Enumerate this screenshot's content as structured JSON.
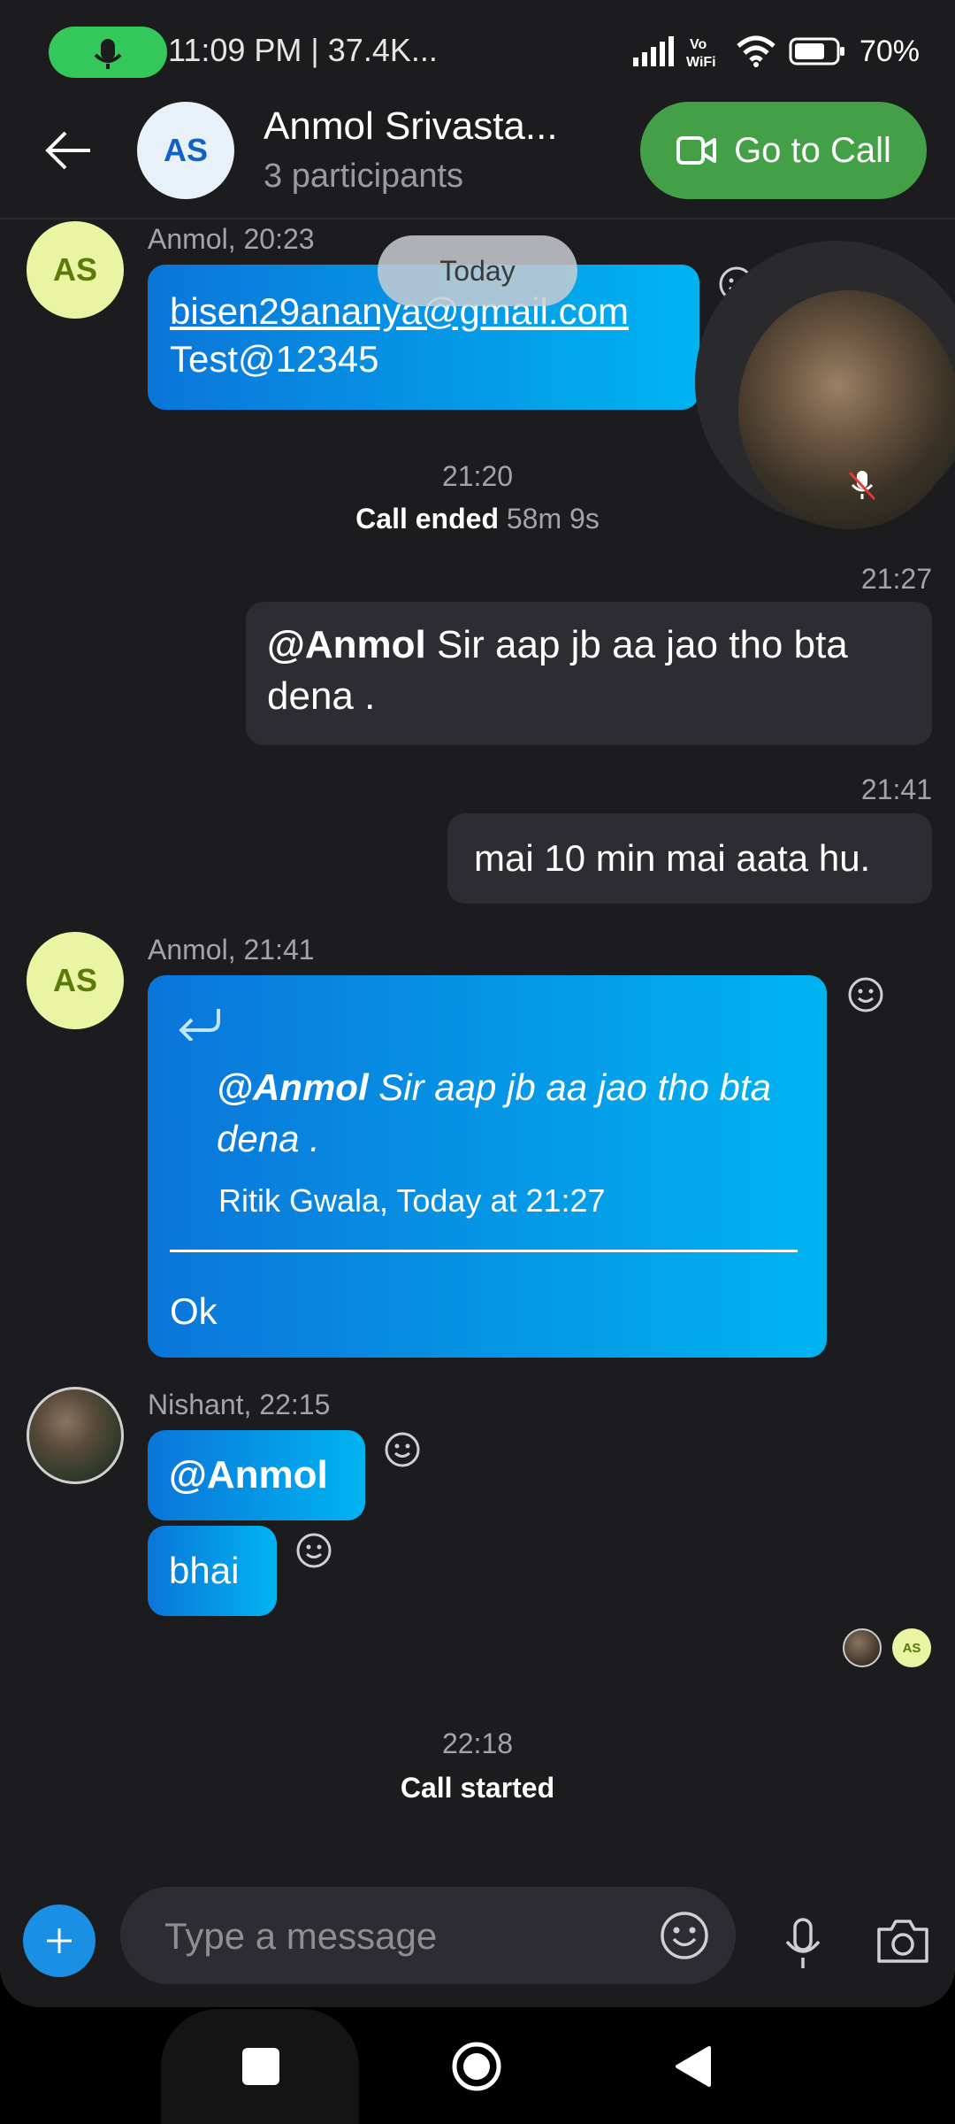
{
  "status_bar": {
    "time_data": "11:09 PM | 37.4K...",
    "battery": "70%"
  },
  "header": {
    "avatar_initials": "AS",
    "name": "Anmol Srivasta...",
    "participants": "3 participants",
    "call_button": "Go to Call"
  },
  "today_label": "Today",
  "messages": {
    "m1": {
      "author": "Anmol, 20:23",
      "avatar": "AS",
      "email": "bisen29ananya@gmail.com",
      "text": "Test@12345"
    },
    "call_ended": {
      "time": "21:20",
      "label": "Call ended",
      "duration": "58m 9s"
    },
    "m2": {
      "time": "21:27",
      "mention": "@Anmol",
      "text": " Sir aap jb aa jao tho bta dena ."
    },
    "m3": {
      "time": "21:41",
      "text": "mai 10 min mai aata hu."
    },
    "m4": {
      "author": "Anmol, 21:41",
      "avatar": "AS",
      "quote_mention": "@Anmol",
      "quote_text": " Sir aap jb aa jao tho bta dena .",
      "quote_meta": "Ritik Gwala, Today at 21:27",
      "reply": "Ok"
    },
    "m5": {
      "author": "Nishant, 22:15",
      "text1": "@Anmol",
      "text2": "bhai"
    },
    "seen_avatar": "AS",
    "call_started": {
      "time": "22:18",
      "label": "Call started"
    }
  },
  "composer": {
    "placeholder": "Type a message"
  },
  "colors": {
    "accent_blue": "#1a8fe3",
    "call_green": "#43a047",
    "status_green": "#34c759"
  }
}
